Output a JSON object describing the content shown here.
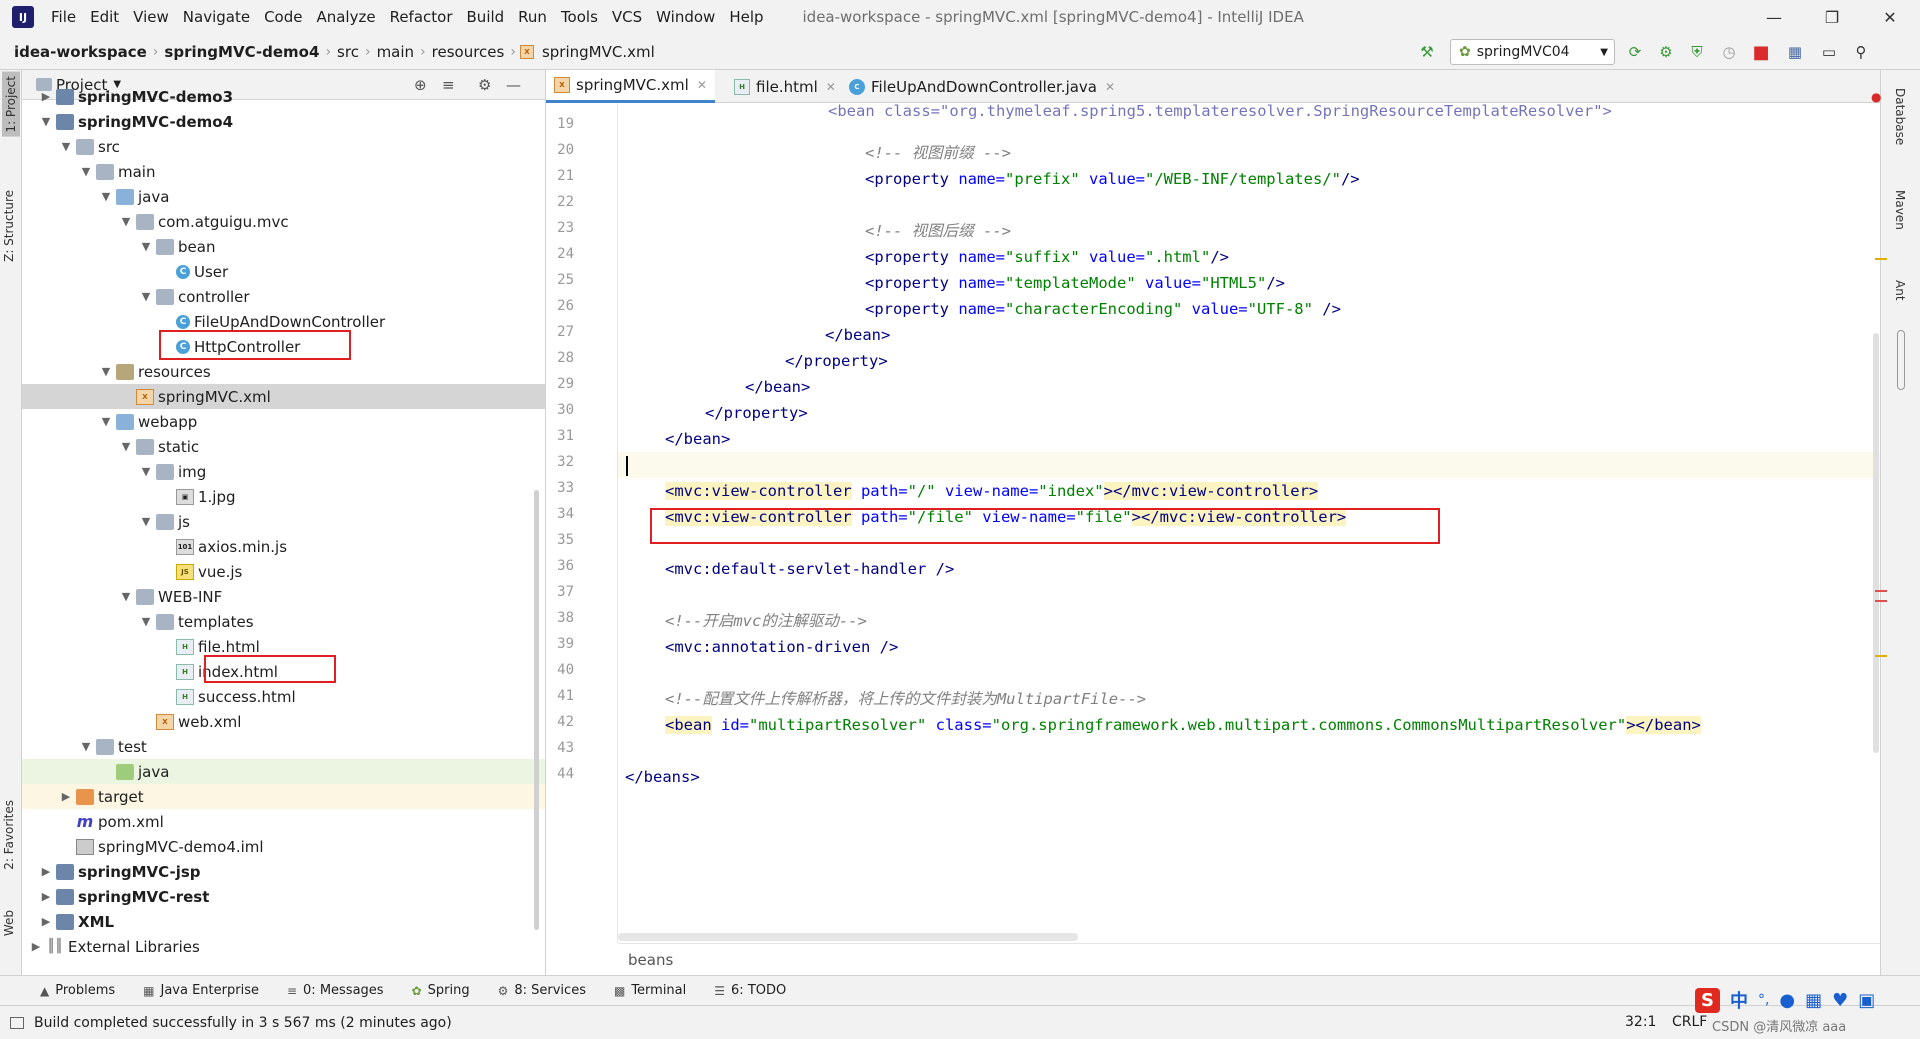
{
  "menu": {
    "items": [
      "File",
      "Edit",
      "View",
      "Navigate",
      "Code",
      "Analyze",
      "Refactor",
      "Build",
      "Run",
      "Tools",
      "VCS",
      "Window",
      "Help"
    ],
    "window_title": "idea-workspace - springMVC.xml [springMVC-demo4] - IntelliJ IDEA"
  },
  "navbar": {
    "crumbs": [
      "idea-workspace",
      "springMVC-demo4",
      "src",
      "main",
      "resources",
      "springMVC.xml"
    ],
    "run_config": "springMVC04"
  },
  "left_stripe": {
    "project": "1: Project",
    "structure": "Z: Structure",
    "favorites": "2: Favorites",
    "web": "Web"
  },
  "right_stripe": {
    "database": "Database",
    "maven": "Maven",
    "ant": "Ant"
  },
  "project_panel": {
    "title": "Project",
    "tree": [
      {
        "label": "springMVC-demo3"
      },
      {
        "label": "springMVC-demo4"
      },
      {
        "label": "src"
      },
      {
        "label": "main"
      },
      {
        "label": "java"
      },
      {
        "label": "com.atguigu.mvc"
      },
      {
        "label": "bean"
      },
      {
        "label": "User"
      },
      {
        "label": "controller"
      },
      {
        "label": "FileUpAndDownController"
      },
      {
        "label": "HttpController"
      },
      {
        "label": "resources"
      },
      {
        "label": "springMVC.xml"
      },
      {
        "label": "webapp"
      },
      {
        "label": "static"
      },
      {
        "label": "img"
      },
      {
        "label": "1.jpg"
      },
      {
        "label": "js"
      },
      {
        "label": "axios.min.js"
      },
      {
        "label": "vue.js"
      },
      {
        "label": "WEB-INF"
      },
      {
        "label": "templates"
      },
      {
        "label": "file.html"
      },
      {
        "label": "index.html"
      },
      {
        "label": "success.html"
      },
      {
        "label": "web.xml"
      },
      {
        "label": "test"
      },
      {
        "label": "java"
      },
      {
        "label": "target"
      },
      {
        "label": "pom.xml"
      },
      {
        "label": "springMVC-demo4.iml"
      },
      {
        "label": "springMVC-jsp"
      },
      {
        "label": "springMVC-rest"
      },
      {
        "label": "XML"
      },
      {
        "label": "External Libraries"
      }
    ]
  },
  "editor": {
    "tabs": [
      "springMVC.xml",
      "file.html",
      "FileUpAndDownController.java"
    ],
    "line_numbers": [
      "19",
      "20",
      "21",
      "22",
      "23",
      "24",
      "25",
      "26",
      "27",
      "28",
      "29",
      "30",
      "31",
      "32",
      "33",
      "34",
      "35",
      "36",
      "37",
      "38",
      "39",
      "40",
      "41",
      "42",
      "43",
      "44"
    ],
    "code": {
      "l19": "<bean class=\"org.thymeleaf.spring5.templateresolver.SpringResourceTemplateResolver\">",
      "l20_comment": "<!-- 视图前缀 -->",
      "l21": [
        "<property",
        " name=",
        "\"prefix\"",
        " value=",
        "\"/WEB-INF/templates/\"",
        "/>"
      ],
      "l23_comment": "<!-- 视图后缀 -->",
      "l24": [
        "<property",
        " name=",
        "\"suffix\"",
        " value=",
        "\".html\"",
        "/>"
      ],
      "l25": [
        "<property",
        " name=",
        "\"templateMode\"",
        " value=",
        "\"HTML5\"",
        "/>"
      ],
      "l26": [
        "<property",
        " name=",
        "\"characterEncoding\"",
        " value=",
        "\"UTF-8\"",
        " />"
      ],
      "l27": "</bean>",
      "l28": "</property>",
      "l29": "</bean>",
      "l30": "</property>",
      "l31": "</bean>",
      "l33": [
        "<mvc:view-controller",
        " path=",
        "\"/\"",
        " view-name=",
        "\"index\"",
        "></mvc:view-controller>"
      ],
      "l34": [
        "<mvc:view-controller",
        " path=",
        "\"/file\"",
        " view-name=",
        "\"file\"",
        "></mvc:view-controller>"
      ],
      "l36": [
        "<mvc:default-servlet-handler",
        " />"
      ],
      "l38_comment": "<!--开启mvc的注解驱动-->",
      "l39": [
        "<mvc:annotation-driven",
        " />"
      ],
      "l41_comment": "<!--配置文件上传解析器，将上传的文件封装为MultipartFile-->",
      "l42": [
        "<bean",
        " id=",
        "\"multipartResolver\"",
        " class=",
        "\"org.springframework.web.multipart.commons.CommonsMultipartResolver\"",
        "></bean>"
      ],
      "l44": "</beans>"
    },
    "breadcrumb": "beans"
  },
  "bottom_tools": [
    "Problems",
    "Java Enterprise",
    "0: Messages",
    "Spring",
    "8: Services",
    "Terminal",
    "6: TODO"
  ],
  "status": {
    "message": "Build completed successfully in 3 s 567 ms (2 minutes ago)",
    "position": "32:1",
    "line_sep": "CRLF",
    "watermark": "CSDN @清风微凉 aaa"
  },
  "ime": {
    "lang": "中",
    "punct": "°,"
  }
}
